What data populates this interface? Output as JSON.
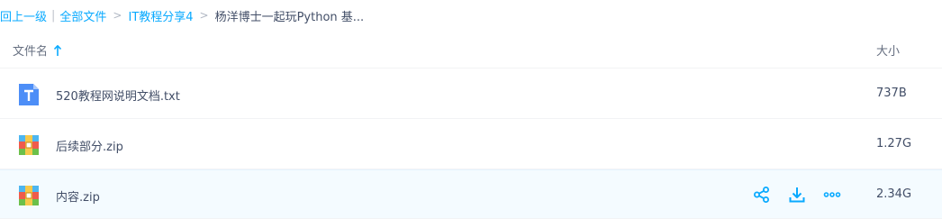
{
  "breadcrumb": {
    "back": "回上一级",
    "separator": "|",
    "all_files": "全部文件",
    "arrow1": ">",
    "folder": "IT教程分享4",
    "arrow2": ">",
    "current": "杨洋博士一起玩Python 基..."
  },
  "header": {
    "name_label": "文件名",
    "size_label": "大小",
    "sort_icon": "arrow-up-icon"
  },
  "files": [
    {
      "name": "520教程网说明文档.txt",
      "size": "737B",
      "icon": "text-file-icon"
    },
    {
      "name": "后续部分.zip",
      "size": "1.27G",
      "icon": "zip-archive-icon"
    },
    {
      "name": "内容.zip",
      "size": "2.34G",
      "icon": "zip-archive-icon"
    }
  ],
  "row_actions": {
    "icons": [
      "share-icon",
      "download-icon",
      "more-icon"
    ]
  },
  "colors": {
    "accent": "#09aaff",
    "hover_bg": "#f4fbff",
    "text": "#424e67"
  }
}
